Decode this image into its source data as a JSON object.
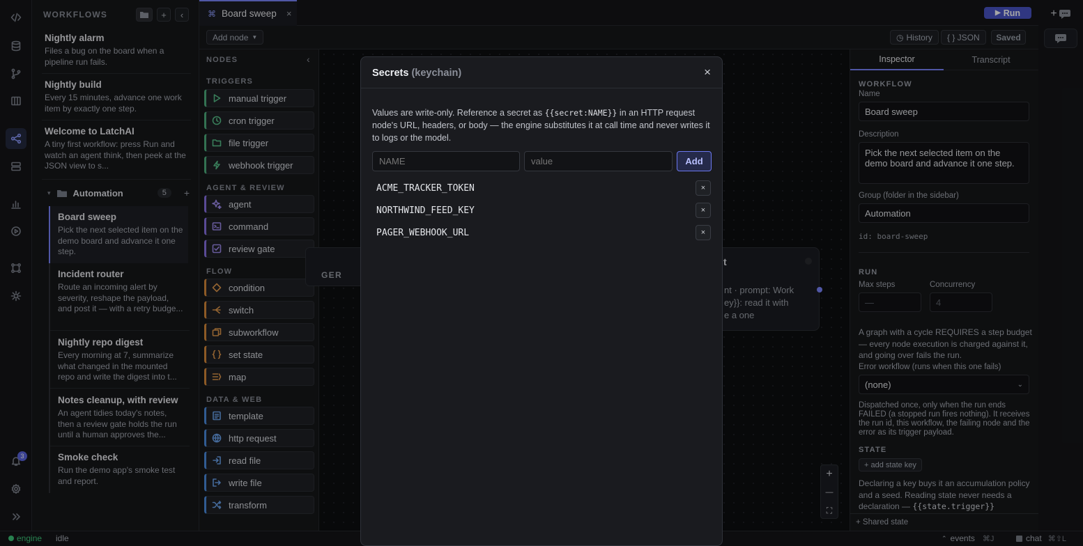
{
  "sidebar": {
    "header": "WORKFLOWS",
    "add_label": "+",
    "collapse_label": "‹",
    "workflows_top": [
      {
        "title": "Nightly alarm",
        "desc": "Files a bug on the board when a pipeline run fails."
      },
      {
        "title": "Nightly build",
        "desc": "Every 15 minutes, advance one work item by exactly one step."
      },
      {
        "title": "Welcome to LatchAI",
        "desc": "A tiny first workflow: press Run and watch an agent think, then peek at the JSON view to s..."
      }
    ],
    "group": {
      "name": "Automation",
      "count": "5",
      "add_label": "+"
    },
    "workflows_group": [
      {
        "title": "Board sweep",
        "desc": "Pick the next selected item on the demo board and advance it one step."
      },
      {
        "title": "Incident router",
        "desc": "Route an incoming alert by severity, reshape the payload, and post it — with a retry budge..."
      },
      {
        "title": "Nightly repo digest",
        "desc": "Every morning at 7, summarize what changed in the mounted repo and write the digest into t..."
      },
      {
        "title": "Notes cleanup, with review",
        "desc": "An agent tidies today's notes, then a review gate holds the run until a human approves the..."
      },
      {
        "title": "Smoke check",
        "desc": "Run the demo app's smoke test and report."
      }
    ]
  },
  "rail": {
    "notification_count": "3"
  },
  "tab": {
    "icon": "⌘",
    "title": "Board sweep",
    "close": "×"
  },
  "run_button": {
    "label": "Run"
  },
  "toolbar": {
    "add_node": "Add node",
    "history": "History",
    "json": "{ } JSON",
    "saved": "Saved"
  },
  "nodes_panel": {
    "header": "NODES",
    "collapse": "‹",
    "sections": {
      "triggers": "TRIGGERS",
      "agent_review": "AGENT & REVIEW",
      "flow": "FLOW",
      "data_web": "DATA & WEB"
    },
    "triggers": [
      "manual trigger",
      "cron trigger",
      "file trigger",
      "webhook trigger"
    ],
    "agent_review": [
      "agent",
      "command",
      "review gate"
    ],
    "flow": [
      "condition",
      "switch",
      "subworkflow",
      "set state",
      "map"
    ],
    "data_web": [
      "template",
      "http request",
      "read file",
      "write file",
      "transform"
    ]
  },
  "canvas": {
    "trigger_node_fragment": "GER",
    "agent_node_fragment_title": "t",
    "agent_node_fragment_lines": [
      "nt · prompt: Work",
      "ey}}: read it with",
      "e a one"
    ],
    "zoom_in": "+",
    "zoom_out": "—",
    "fit": "⛶"
  },
  "inspector": {
    "tabs": [
      "Inspector",
      "Transcript"
    ],
    "workflow_section": "WORKFLOW",
    "name_label": "Name",
    "name_value": "Board sweep",
    "description_label": "Description",
    "description_value": "Pick the next selected item on the demo board and advance it one step.",
    "group_label": "Group (folder in the sidebar)",
    "group_value": "Automation",
    "id_text": "id: board-sweep",
    "run_section": "RUN",
    "max_steps_label": "Max steps",
    "max_steps_placeholder": "—",
    "concurrency_label": "Concurrency",
    "concurrency_placeholder": "4",
    "budget_help": "A graph with a cycle REQUIRES a step budget — every node execution is charged against it, and going over fails the run.",
    "error_workflow_label": "Error workflow (runs when this one fails)",
    "error_workflow_value": "(none)",
    "error_help": "Dispatched once, only when the run ends FAILED (a stopped run fires nothing). It receives the run id, this workflow, the failing node and the error as its trigger payload.",
    "state_section": "STATE",
    "add_state_key": "+ add state key",
    "state_help_prefix": "Declaring a key buys it an accumulation policy and a seed. Reading state never needs a declaration — ",
    "state_help_code": "{{state.trigger}}",
    "shared_state": "+ Shared state"
  },
  "modal": {
    "title": "Secrets",
    "title_suffix": "(keychain)",
    "close": "×",
    "intro_a": "Values are write-only. Reference a secret as ",
    "intro_code": "{{secret:NAME}}",
    "intro_b": " in an HTTP request node's URL, headers, or body — the engine substitutes it at call time and never writes it to logs or the model.",
    "name_placeholder": "NAME",
    "value_placeholder": "value",
    "add_label": "Add",
    "delete_label": "×",
    "secrets": [
      "ACME_TRACKER_TOKEN",
      "NORTHWIND_FEED_KEY",
      "PAGER_WEBHOOK_URL"
    ]
  },
  "status_bar": {
    "engine": "engine",
    "state": "idle",
    "events": "events",
    "events_shortcut": "⌘J",
    "chat": "chat",
    "chat_shortcut": "⌘⇧L"
  },
  "colors": {
    "accent": "#7b86ff",
    "run": "#4a55c8",
    "engine_ok": "#3ec77a"
  }
}
